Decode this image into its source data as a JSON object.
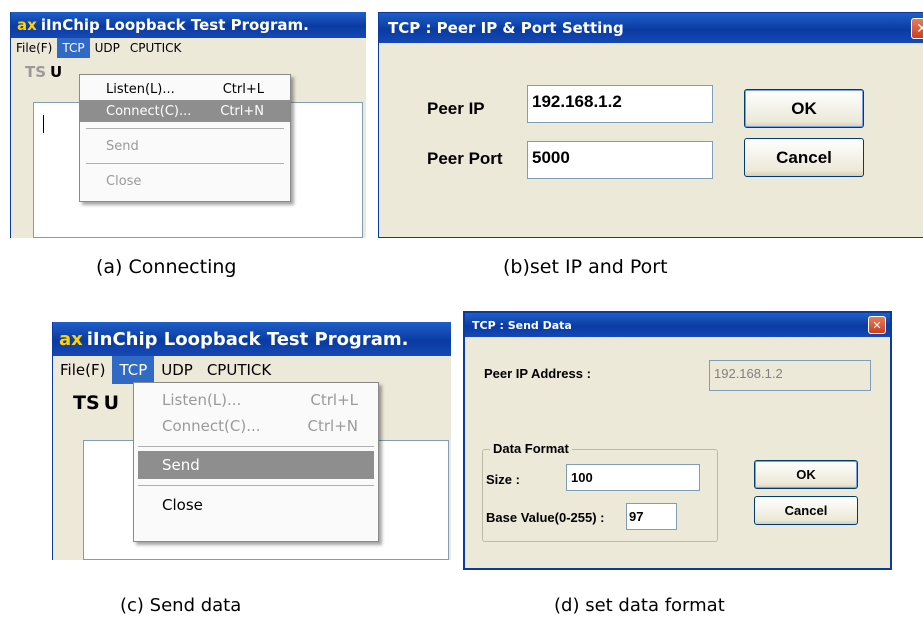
{
  "panel_a": {
    "title": "iInChip Loopback Test Program.",
    "app_mark": "ax",
    "menu": [
      "File(F)",
      "TCP",
      "UDP",
      "CPUTICK"
    ],
    "toolbar": [
      "TS",
      "U"
    ],
    "dropdown": {
      "items": [
        {
          "label": "Listen(L)...",
          "shortcut": "Ctrl+L"
        },
        {
          "label": "Connect(C)...",
          "shortcut": "Ctrl+N"
        },
        {
          "label": "Send",
          "shortcut": ""
        },
        {
          "label": "Close",
          "shortcut": ""
        }
      ]
    },
    "caption": "(a) Connecting"
  },
  "panel_b": {
    "title": "TCP : Peer IP & Port Setting",
    "peer_ip_label": "Peer IP",
    "peer_ip_value": "192.168.1.2",
    "peer_port_label": "Peer Port",
    "peer_port_value": "5000",
    "ok": "OK",
    "cancel": "Cancel",
    "caption": "(b)set IP and Port"
  },
  "panel_c": {
    "title": "iInChip Loopback Test Program.",
    "app_mark": "ax",
    "menu": [
      "File(F)",
      "TCP",
      "UDP",
      "CPUTICK"
    ],
    "toolbar": [
      "TS",
      "U"
    ],
    "dropdown": {
      "items": [
        {
          "label": "Listen(L)...",
          "shortcut": "Ctrl+L"
        },
        {
          "label": "Connect(C)...",
          "shortcut": "Ctrl+N"
        },
        {
          "label": "Send",
          "shortcut": ""
        },
        {
          "label": "Close",
          "shortcut": ""
        }
      ]
    },
    "caption": "(c)  Send data"
  },
  "panel_d": {
    "title": "TCP : Send Data",
    "peer_ip_label": "Peer IP Address :",
    "peer_ip_value": "192.168.1.2",
    "group_label": "Data Format",
    "size_label": "Size :",
    "size_value": "100",
    "base_label": "Base Value(0-255) :",
    "base_value": "97",
    "ok": "OK",
    "cancel": "Cancel",
    "caption": "(d) set data format"
  },
  "colors": {
    "titlebar": "#0a3ba3",
    "menu_highlight": "#316ac5",
    "item_highlight": "#8e8e8e",
    "close_button": "#c8401e"
  }
}
